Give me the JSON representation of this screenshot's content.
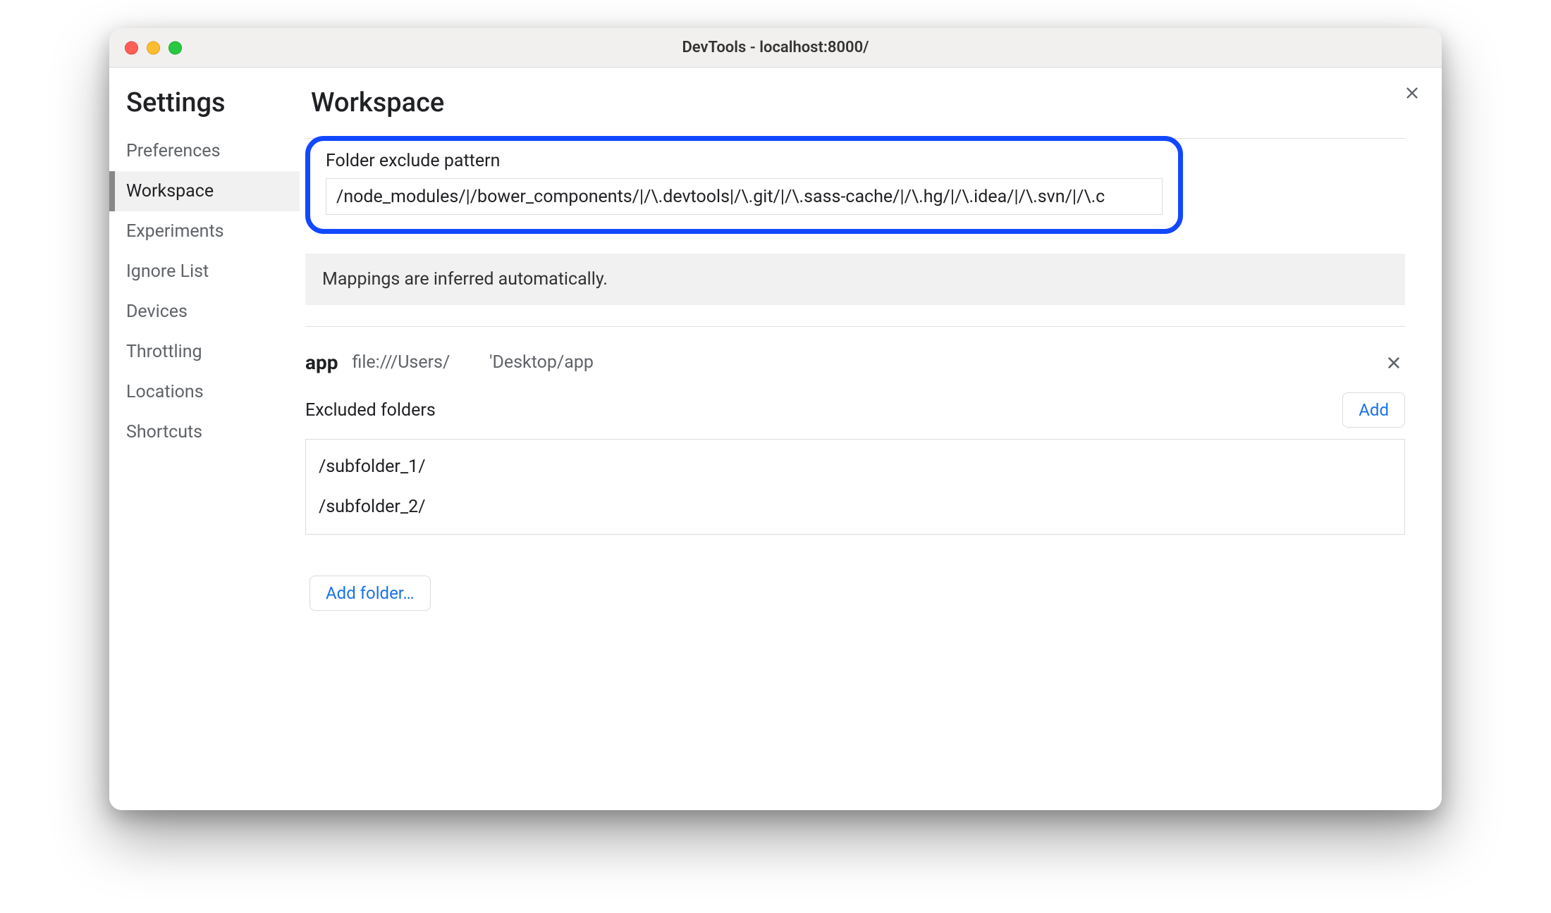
{
  "window": {
    "title": "DevTools - localhost:8000/"
  },
  "sidebar": {
    "title": "Settings",
    "items": [
      {
        "label": "Preferences",
        "active": false
      },
      {
        "label": "Workspace",
        "active": true
      },
      {
        "label": "Experiments",
        "active": false
      },
      {
        "label": "Ignore List",
        "active": false
      },
      {
        "label": "Devices",
        "active": false
      },
      {
        "label": "Throttling",
        "active": false
      },
      {
        "label": "Locations",
        "active": false
      },
      {
        "label": "Shortcuts",
        "active": false
      }
    ]
  },
  "page": {
    "title": "Workspace",
    "exclude_pattern": {
      "label": "Folder exclude pattern",
      "value": "/node_modules/|/bower_components/|/\\.devtools|/\\.git/|/\\.sass-cache/|/\\.hg/|/\\.idea/|/\\.svn/|/\\.c"
    },
    "info": "Mappings are inferred automatically.",
    "folder": {
      "name": "app",
      "path_left": "file:///Users/",
      "path_right": "'Desktop/app"
    },
    "excluded": {
      "title": "Excluded folders",
      "add_label": "Add",
      "items": [
        "/subfolder_1/",
        "/subfolder_2/"
      ]
    },
    "add_folder_label": "Add folder…"
  }
}
